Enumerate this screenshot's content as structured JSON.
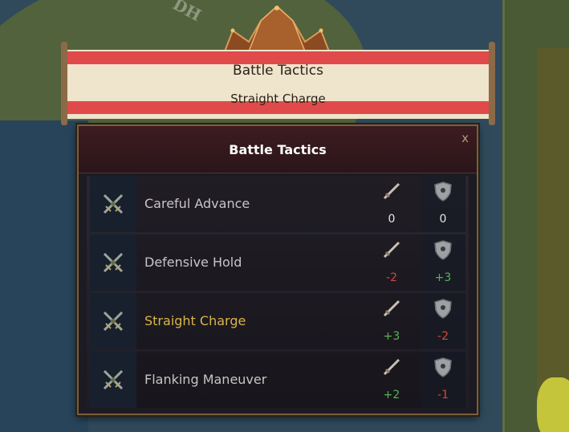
{
  "map": {
    "fragment": "DH"
  },
  "banner": {
    "title": "Battle Tactics",
    "subtitle": "Straight Charge"
  },
  "panel": {
    "title": "Battle Tactics",
    "close": "x"
  },
  "colors": {
    "positive": "#55b555",
    "negative": "#d34a3a",
    "neutral": "#e6e6e6",
    "selected": "#d9b54a"
  },
  "tactics": [
    {
      "name": "Careful Advance",
      "attack": "0",
      "defense": "0"
    },
    {
      "name": "Defensive Hold",
      "attack": "-2",
      "defense": "+3"
    },
    {
      "name": "Straight Charge",
      "attack": "+3",
      "defense": "-2",
      "selected": true
    },
    {
      "name": "Flanking Maneuver",
      "attack": "+2",
      "defense": "-1"
    }
  ]
}
